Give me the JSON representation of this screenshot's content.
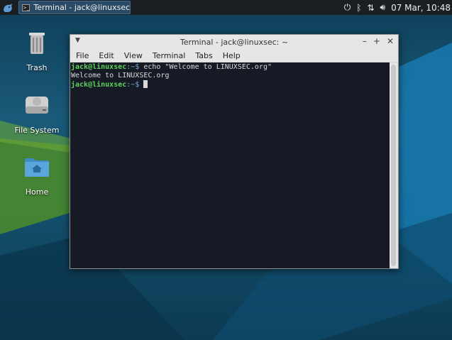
{
  "panel": {
    "task_title": "Terminal - jack@linuxsec: ~",
    "task_icon_glyph": ">_",
    "clock": "07 Mar, 10:48"
  },
  "desktop": {
    "icons": [
      {
        "label": "Trash"
      },
      {
        "label": "File System"
      },
      {
        "label": "Home"
      }
    ]
  },
  "window": {
    "title": "Terminal - jack@linuxsec: ~",
    "menu": [
      "File",
      "Edit",
      "View",
      "Terminal",
      "Tabs",
      "Help"
    ]
  },
  "terminal": {
    "user": "jack@linuxsec",
    "path": ":~$",
    "command": " echo \"Welcome to LINUXSEC.org\"",
    "output": "Welcome to LINUXSEC.org"
  },
  "colors": {
    "prompt_user": "#5ed35e",
    "terminal_bg": "#151a24",
    "panel_bg": "#1b1e22"
  }
}
